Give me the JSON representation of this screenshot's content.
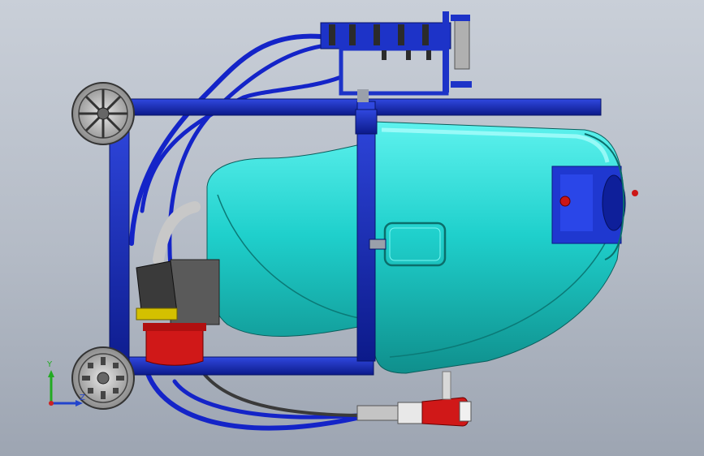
{
  "view": {
    "type": "cad-3d-model",
    "subject_icons": [
      "wheel-icon",
      "tank-icon",
      "pump-icon",
      "hose-icon",
      "spray-nozzle-icon",
      "axis-triad-icon"
    ]
  },
  "triad": {
    "y_label": "Y",
    "z_label": "Z",
    "colors": {
      "x": "#cc2222",
      "y": "#22aa22",
      "z": "#2244cc"
    }
  },
  "colors": {
    "frame": "#1a2fb8",
    "tank": "#22d4d0",
    "hose": "#1424c8",
    "motor": "#d01818",
    "wheel": "#c4c4c4",
    "background_top": "#c9cfd8",
    "background_bottom": "#9da5b2"
  }
}
